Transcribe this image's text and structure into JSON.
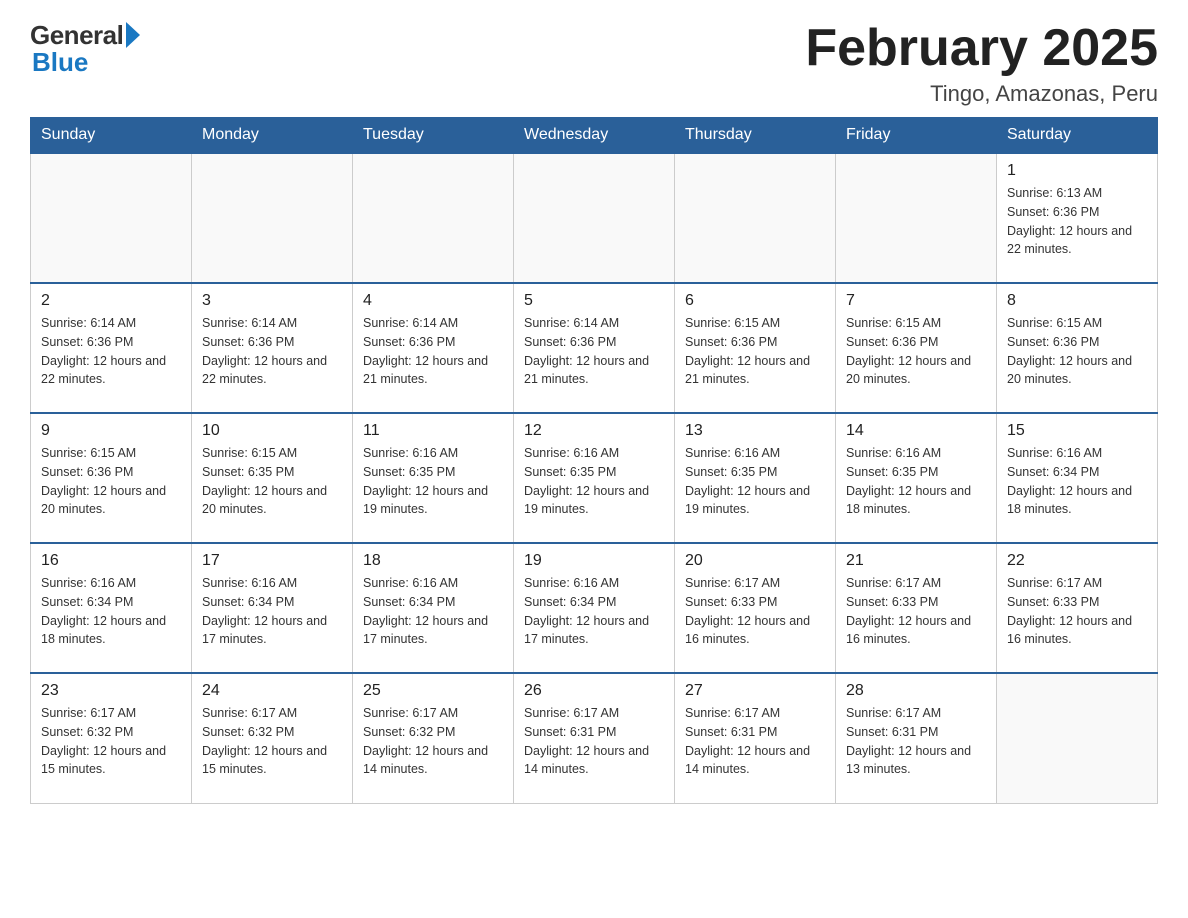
{
  "header": {
    "logo_general": "General",
    "logo_blue": "Blue",
    "month_title": "February 2025",
    "location": "Tingo, Amazonas, Peru"
  },
  "days_of_week": [
    "Sunday",
    "Monday",
    "Tuesday",
    "Wednesday",
    "Thursday",
    "Friday",
    "Saturday"
  ],
  "weeks": [
    [
      {
        "day": "",
        "info": ""
      },
      {
        "day": "",
        "info": ""
      },
      {
        "day": "",
        "info": ""
      },
      {
        "day": "",
        "info": ""
      },
      {
        "day": "",
        "info": ""
      },
      {
        "day": "",
        "info": ""
      },
      {
        "day": "1",
        "info": "Sunrise: 6:13 AM\nSunset: 6:36 PM\nDaylight: 12 hours and 22 minutes."
      }
    ],
    [
      {
        "day": "2",
        "info": "Sunrise: 6:14 AM\nSunset: 6:36 PM\nDaylight: 12 hours and 22 minutes."
      },
      {
        "day": "3",
        "info": "Sunrise: 6:14 AM\nSunset: 6:36 PM\nDaylight: 12 hours and 22 minutes."
      },
      {
        "day": "4",
        "info": "Sunrise: 6:14 AM\nSunset: 6:36 PM\nDaylight: 12 hours and 21 minutes."
      },
      {
        "day": "5",
        "info": "Sunrise: 6:14 AM\nSunset: 6:36 PM\nDaylight: 12 hours and 21 minutes."
      },
      {
        "day": "6",
        "info": "Sunrise: 6:15 AM\nSunset: 6:36 PM\nDaylight: 12 hours and 21 minutes."
      },
      {
        "day": "7",
        "info": "Sunrise: 6:15 AM\nSunset: 6:36 PM\nDaylight: 12 hours and 20 minutes."
      },
      {
        "day": "8",
        "info": "Sunrise: 6:15 AM\nSunset: 6:36 PM\nDaylight: 12 hours and 20 minutes."
      }
    ],
    [
      {
        "day": "9",
        "info": "Sunrise: 6:15 AM\nSunset: 6:36 PM\nDaylight: 12 hours and 20 minutes."
      },
      {
        "day": "10",
        "info": "Sunrise: 6:15 AM\nSunset: 6:35 PM\nDaylight: 12 hours and 20 minutes."
      },
      {
        "day": "11",
        "info": "Sunrise: 6:16 AM\nSunset: 6:35 PM\nDaylight: 12 hours and 19 minutes."
      },
      {
        "day": "12",
        "info": "Sunrise: 6:16 AM\nSunset: 6:35 PM\nDaylight: 12 hours and 19 minutes."
      },
      {
        "day": "13",
        "info": "Sunrise: 6:16 AM\nSunset: 6:35 PM\nDaylight: 12 hours and 19 minutes."
      },
      {
        "day": "14",
        "info": "Sunrise: 6:16 AM\nSunset: 6:35 PM\nDaylight: 12 hours and 18 minutes."
      },
      {
        "day": "15",
        "info": "Sunrise: 6:16 AM\nSunset: 6:34 PM\nDaylight: 12 hours and 18 minutes."
      }
    ],
    [
      {
        "day": "16",
        "info": "Sunrise: 6:16 AM\nSunset: 6:34 PM\nDaylight: 12 hours and 18 minutes."
      },
      {
        "day": "17",
        "info": "Sunrise: 6:16 AM\nSunset: 6:34 PM\nDaylight: 12 hours and 17 minutes."
      },
      {
        "day": "18",
        "info": "Sunrise: 6:16 AM\nSunset: 6:34 PM\nDaylight: 12 hours and 17 minutes."
      },
      {
        "day": "19",
        "info": "Sunrise: 6:16 AM\nSunset: 6:34 PM\nDaylight: 12 hours and 17 minutes."
      },
      {
        "day": "20",
        "info": "Sunrise: 6:17 AM\nSunset: 6:33 PM\nDaylight: 12 hours and 16 minutes."
      },
      {
        "day": "21",
        "info": "Sunrise: 6:17 AM\nSunset: 6:33 PM\nDaylight: 12 hours and 16 minutes."
      },
      {
        "day": "22",
        "info": "Sunrise: 6:17 AM\nSunset: 6:33 PM\nDaylight: 12 hours and 16 minutes."
      }
    ],
    [
      {
        "day": "23",
        "info": "Sunrise: 6:17 AM\nSunset: 6:32 PM\nDaylight: 12 hours and 15 minutes."
      },
      {
        "day": "24",
        "info": "Sunrise: 6:17 AM\nSunset: 6:32 PM\nDaylight: 12 hours and 15 minutes."
      },
      {
        "day": "25",
        "info": "Sunrise: 6:17 AM\nSunset: 6:32 PM\nDaylight: 12 hours and 14 minutes."
      },
      {
        "day": "26",
        "info": "Sunrise: 6:17 AM\nSunset: 6:31 PM\nDaylight: 12 hours and 14 minutes."
      },
      {
        "day": "27",
        "info": "Sunrise: 6:17 AM\nSunset: 6:31 PM\nDaylight: 12 hours and 14 minutes."
      },
      {
        "day": "28",
        "info": "Sunrise: 6:17 AM\nSunset: 6:31 PM\nDaylight: 12 hours and 13 minutes."
      },
      {
        "day": "",
        "info": ""
      }
    ]
  ]
}
